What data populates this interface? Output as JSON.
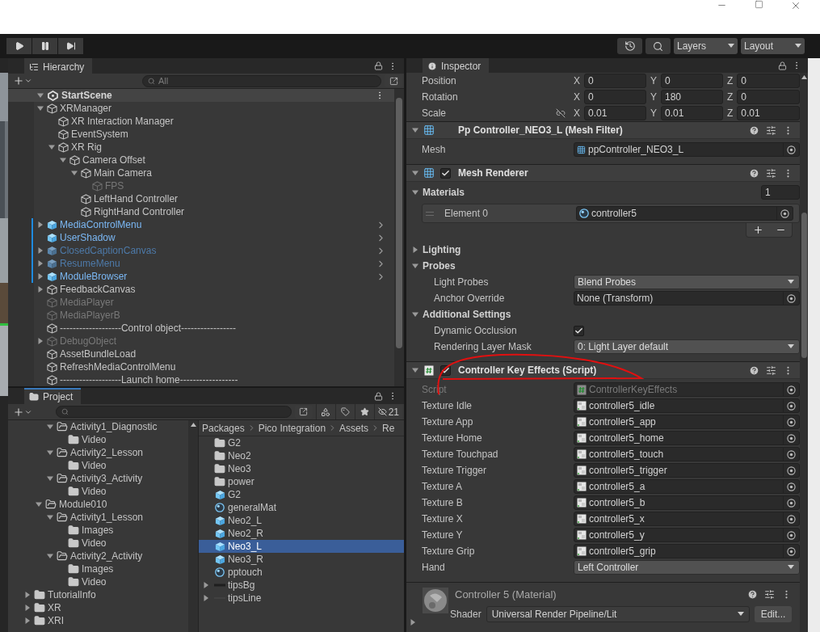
{
  "toolbar": {
    "layers": "Layers",
    "layout": "Layout"
  },
  "hierarchy": {
    "title": "Hierarchy",
    "focused": false,
    "search": {
      "placeholder": "All"
    },
    "scene": {
      "name": "StartScene",
      "expanded": true
    },
    "items": [
      {
        "name": "XRManager",
        "kind": "object",
        "expanded": true,
        "active": true,
        "children": [
          {
            "name": "XR Interaction Manager",
            "kind": "object",
            "active": true
          },
          {
            "name": "EventSystem",
            "kind": "object",
            "active": true
          },
          {
            "name": "XR Rig",
            "kind": "object",
            "expanded": true,
            "active": true,
            "children": [
              {
                "name": "Camera Offset",
                "kind": "object",
                "expanded": true,
                "active": true,
                "children": [
                  {
                    "name": "Main Camera",
                    "kind": "object",
                    "expanded": true,
                    "active": true,
                    "children": [
                      {
                        "name": "FPS",
                        "kind": "object",
                        "active": false
                      }
                    ]
                  },
                  {
                    "name": "LeftHand Controller",
                    "kind": "object",
                    "active": true
                  },
                  {
                    "name": "RightHand Controller",
                    "kind": "object",
                    "active": true
                  }
                ]
              }
            ]
          }
        ]
      },
      {
        "name": "MediaControlMenu",
        "kind": "prefab",
        "expanded": false,
        "active": true
      },
      {
        "name": "UserShadow",
        "kind": "prefab",
        "active": true
      },
      {
        "name": "ClosedCaptionCanvas",
        "kind": "prefab",
        "expanded": false,
        "active": false
      },
      {
        "name": "ResumeMenu",
        "kind": "prefab",
        "expanded": false,
        "active": false
      },
      {
        "name": "ModuleBrowser",
        "kind": "prefab",
        "expanded": false,
        "active": true
      },
      {
        "name": "FeedbackCanvas",
        "kind": "object",
        "expanded": false,
        "active": true
      },
      {
        "name": "MediaPlayer",
        "kind": "object",
        "active": false
      },
      {
        "name": "MediaPlayerB",
        "kind": "object",
        "active": false
      },
      {
        "name": "-------------------Control object-----------------",
        "kind": "object",
        "active": true
      },
      {
        "name": "DebugObject",
        "kind": "object",
        "expanded": false,
        "active": false
      },
      {
        "name": "AssetBundleLoad",
        "kind": "object",
        "active": true
      },
      {
        "name": "RefreshMediaControlMenu",
        "kind": "object",
        "active": true
      },
      {
        "name": "-------------------Launch home------------------",
        "kind": "object",
        "active": true
      }
    ]
  },
  "project": {
    "title": "Project",
    "focused": true,
    "hidden_count": "21",
    "folders": [
      {
        "children": [
          {
            "children": [
              {
                "name": "Activity1_Diagnostic",
                "expanded": true,
                "children": [
                  {
                    "name": "Video"
                  }
                ]
              },
              {
                "name": "Activity2_Lesson",
                "expanded": true,
                "children": [
                  {
                    "name": "Video"
                  }
                ]
              },
              {
                "name": "Activity3_Activity",
                "expanded": true,
                "children": [
                  {
                    "name": "Video"
                  }
                ]
              }
            ]
          },
          {
            "name": "Module010",
            "expanded": true,
            "children": [
              {
                "name": "Activity1_Lesson",
                "expanded": true,
                "children": [
                  {
                    "name": "Images"
                  },
                  {
                    "name": "Video"
                  }
                ]
              },
              {
                "name": "Activity2_Activity",
                "expanded": true,
                "children": [
                  {
                    "name": "Images"
                  },
                  {
                    "name": "Video"
                  }
                ]
              }
            ]
          }
        ]
      },
      {
        "name": "TutorialInfo",
        "expanded": false
      },
      {
        "name": "XR",
        "expanded": false
      },
      {
        "name": "XRI",
        "expanded": false
      }
    ],
    "breadcrumb": [
      "Packages",
      "Pico Integration",
      "Assets",
      "Re"
    ],
    "assets": [
      {
        "name": "G2",
        "kind": "folder",
        "selected": false
      },
      {
        "name": "Neo2",
        "kind": "folder",
        "selected": false
      },
      {
        "name": "Neo3",
        "kind": "folder",
        "selected": false
      },
      {
        "name": "power",
        "kind": "folder",
        "selected": false
      },
      {
        "name": "G2",
        "kind": "prefab",
        "selected": false
      },
      {
        "name": "generalMat",
        "kind": "material",
        "selected": false
      },
      {
        "name": "Neo2_L",
        "kind": "prefab",
        "selected": false
      },
      {
        "name": "Neo2_R",
        "kind": "prefab",
        "selected": false
      },
      {
        "name": "Neo3_L",
        "kind": "prefab",
        "selected": true
      },
      {
        "name": "Neo3_R",
        "kind": "prefab",
        "selected": false
      },
      {
        "name": "pptouch",
        "kind": "material",
        "selected": false
      },
      {
        "name": "tipsBg",
        "kind": "sprite",
        "expanded": false,
        "selected": false
      },
      {
        "name": "tipsLine",
        "kind": "line",
        "expanded": false,
        "selected": false
      }
    ]
  },
  "inspector": {
    "title": "Inspector",
    "focused": false,
    "transform": [
      {
        "label": "Position",
        "proportions_toggle": false,
        "values": [
          {
            "axis": "X",
            "value": "0"
          },
          {
            "axis": "Y",
            "value": "0"
          },
          {
            "axis": "Z",
            "value": "0"
          }
        ]
      },
      {
        "label": "Rotation",
        "proportions_toggle": false,
        "values": [
          {
            "axis": "X",
            "value": "0"
          },
          {
            "axis": "Y",
            "value": "180"
          },
          {
            "axis": "Z",
            "value": "0"
          }
        ]
      },
      {
        "label": "Scale",
        "proportions_toggle": true,
        "values": [
          {
            "axis": "X",
            "value": "0.01"
          },
          {
            "axis": "Y",
            "value": "0.01"
          },
          {
            "axis": "Z",
            "value": "0.01"
          }
        ]
      }
    ],
    "components": [
      {
        "kind": "mesh_filter",
        "title": "Pp Controller_NEO3_L (Mesh Filter)",
        "expanded": true,
        "fields": [
          {
            "kind": "mesh",
            "label": "Mesh",
            "value": "ppController_NEO3_L",
            "disabled": false
          }
        ]
      },
      {
        "kind": "mesh_renderer",
        "title": "Mesh Renderer",
        "enabled": true,
        "expanded": true,
        "fields": [
          {
            "kind": "section",
            "label": "Materials",
            "expanded": true,
            "count": "1",
            "children": [
              {
                "kind": "element",
                "label": "Element 0",
                "value": "controller5",
                "disabled": false
              },
              {
                "kind": "add_remove"
              }
            ]
          },
          {
            "kind": "section",
            "label": "Lighting",
            "expanded": false
          },
          {
            "kind": "section",
            "label": "Probes",
            "expanded": true,
            "children": [
              {
                "kind": "dropdown",
                "label": "Light Probes",
                "value": "Blend Probes",
                "disabled": false
              },
              {
                "kind": "object",
                "label": "Anchor Override",
                "value": "None (Transform)",
                "disabled": false
              }
            ]
          },
          {
            "kind": "section",
            "label": "Additional Settings",
            "expanded": true,
            "children": [
              {
                "kind": "checkbox",
                "label": "Dynamic Occlusion",
                "checked": true,
                "disabled": false
              },
              {
                "kind": "dropdown",
                "label": "Rendering Layer Mask",
                "value": "0: Light Layer default",
                "disabled": false
              }
            ]
          }
        ]
      },
      {
        "kind": "script",
        "title": "Controller Key Effects (Script)",
        "enabled": true,
        "expanded": true,
        "fields": [
          {
            "kind": "script",
            "label": "Script",
            "value": "ControllerKeyEffects",
            "disabled": true
          },
          {
            "kind": "texture",
            "label": "Texture Idle",
            "value": "controller5_idle",
            "disabled": false
          },
          {
            "kind": "texture",
            "label": "Texture App",
            "value": "controller5_app",
            "disabled": false
          },
          {
            "kind": "texture",
            "label": "Texture Home",
            "value": "controller5_home",
            "disabled": false
          },
          {
            "kind": "texture",
            "label": "Texture Touchpad",
            "value": "controller5_touch",
            "disabled": false
          },
          {
            "kind": "texture",
            "label": "Texture Trigger",
            "value": "controller5_trigger",
            "disabled": false
          },
          {
            "kind": "texture",
            "label": "Texture A",
            "value": "controller5_a",
            "disabled": false
          },
          {
            "kind": "texture",
            "label": "Texture B",
            "value": "controller5_b",
            "disabled": false
          },
          {
            "kind": "texture",
            "label": "Texture X",
            "value": "controller5_x",
            "disabled": false
          },
          {
            "kind": "texture",
            "label": "Texture Y",
            "value": "controller5_y",
            "disabled": false
          },
          {
            "kind": "texture",
            "label": "Texture Grip",
            "value": "controller5_grip",
            "disabled": false
          },
          {
            "kind": "dropdown",
            "label": "Hand",
            "value": "Left Controller",
            "disabled": false
          }
        ]
      },
      {
        "kind": "material",
        "title": "Controller 5 (Material)",
        "expanded": false,
        "shader_label": "Shader",
        "shader": "Universal Render Pipeline/Lit",
        "edit": "Edit..."
      }
    ]
  }
}
